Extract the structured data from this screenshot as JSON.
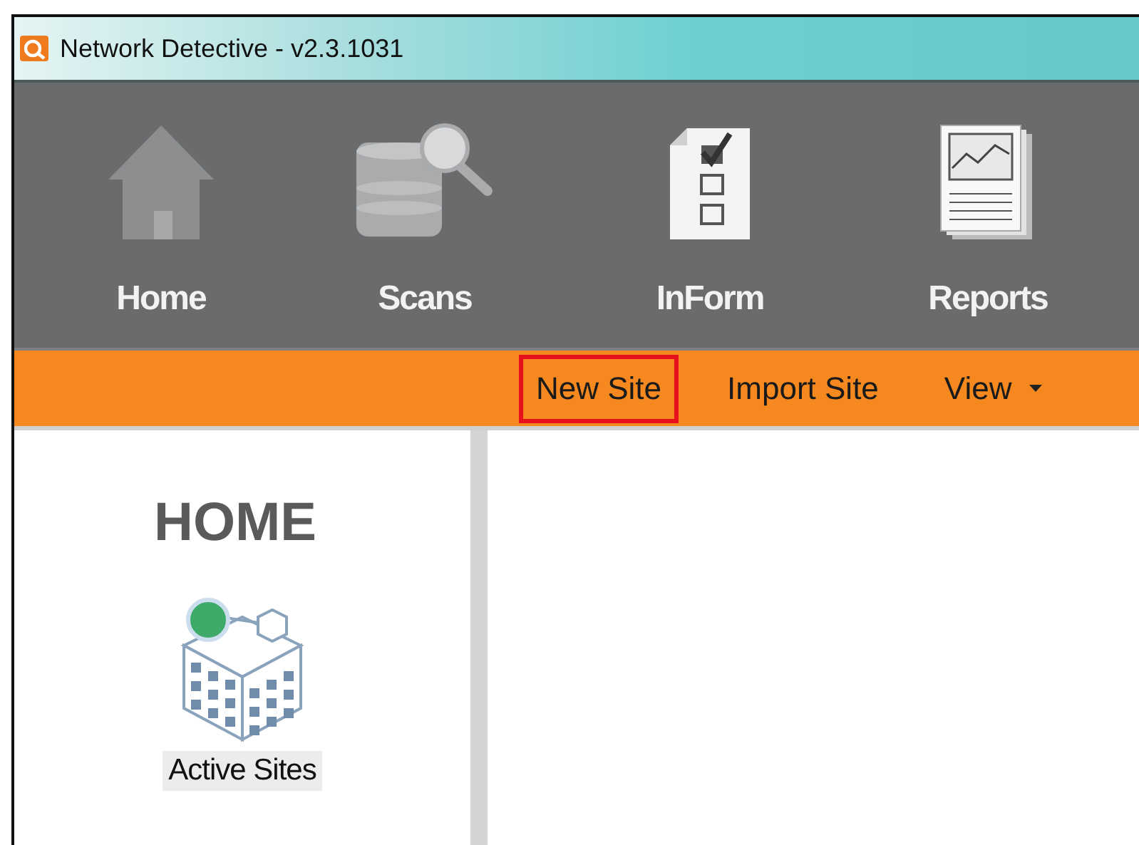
{
  "window": {
    "title": "Network Detective - v2.3.1031"
  },
  "ribbon": [
    {
      "label": "Home",
      "kind": "home"
    },
    {
      "label": "Scans",
      "kind": "scans"
    },
    {
      "label": "InForm",
      "kind": "inform"
    },
    {
      "label": "Reports",
      "kind": "reports"
    }
  ],
  "actions": [
    {
      "label": "New Site",
      "kind": "button",
      "highlighted": true
    },
    {
      "label": "Import Site",
      "kind": "button",
      "highlighted": false
    },
    {
      "label": "View",
      "kind": "dropdown",
      "highlighted": false
    }
  ],
  "sidebar": {
    "heading": "HOME",
    "items": [
      {
        "label": "Active Sites",
        "selected": true
      }
    ]
  }
}
